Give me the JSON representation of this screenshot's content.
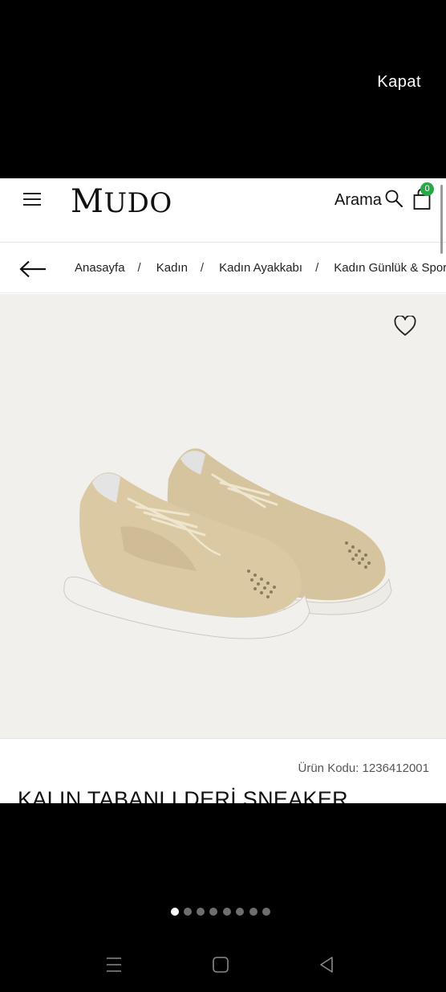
{
  "viewer": {
    "close_label": "Kapat",
    "dots_total": 8,
    "active_dot": 0
  },
  "header": {
    "logo": {
      "first": "M",
      "rest": "UDO"
    },
    "search_label": "Arama",
    "cart_count": "0"
  },
  "breadcrumb": {
    "items": [
      "Anasayfa",
      "Kadın",
      "Kadın Ayakkabı",
      "Kadın Günlük & Spor"
    ],
    "separator": "/"
  },
  "product": {
    "sku_text": "Ürün Kodu: 1236412001",
    "title": "KALIN TABANLI DERİ SNEAKER"
  },
  "colors": {
    "badge": "#2aa846",
    "gallery_bg": "#f1f0ec",
    "suede": "#d9c8a3"
  },
  "icons": {
    "menu": "hamburger-icon",
    "search": "magnifier-icon",
    "cart": "shopping-bag-icon",
    "back": "arrow-left-icon",
    "favorite": "heart-outline-icon"
  }
}
